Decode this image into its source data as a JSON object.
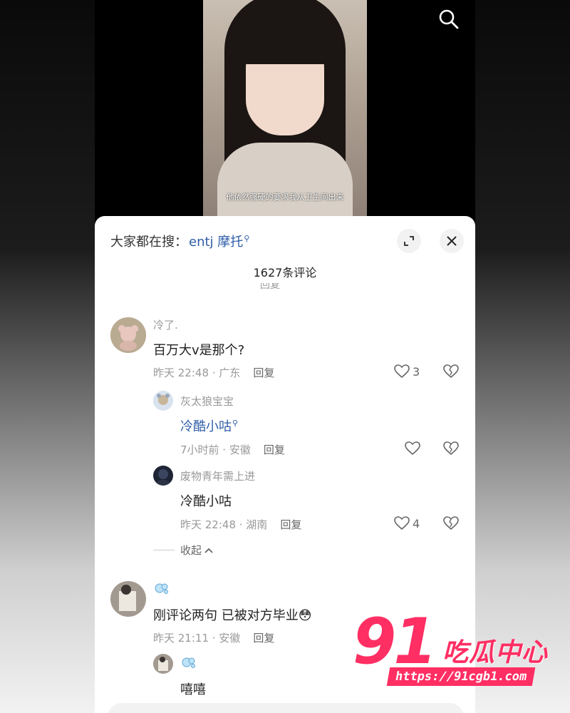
{
  "video": {
    "subtitle": "他依然强硬的要求我从卫生间出来",
    "search_icon": "search-icon"
  },
  "sheet": {
    "search_prefix": "大家都在搜：",
    "search_query": "entj 摩托",
    "expand_icon": "expand-icon",
    "close_icon": "close-icon",
    "comment_count": "1627条评论",
    "partial_row_reply": "回复"
  },
  "comments": [
    {
      "username": "冷了.",
      "text": "百万大v是那个?",
      "time_loc": "昨天 22:48 · 广东",
      "reply": "回复",
      "likes": "3",
      "replies": [
        {
          "username": "灰太狼宝宝",
          "text": "冷酷小咕",
          "time_loc": "7小时前 · 安徽",
          "reply": "回复",
          "likes": ""
        },
        {
          "username": "废物青年需上进",
          "text": "冷酷小咕",
          "time_loc": "昨天 22:48 · 湖南",
          "reply": "回复",
          "likes": "4"
        }
      ],
      "collapse_label": "收起"
    },
    {
      "username": "",
      "text": "刚评论两句 已被对方毕业😳",
      "time_loc": "昨天 21:11 · 安徽",
      "reply": "回复",
      "replies": [
        {
          "username": "",
          "text": "嘻嘻"
        }
      ]
    }
  ],
  "watermark": {
    "number": "91",
    "brand": "吃瓜中心",
    "url": "https://91cgb1.com"
  },
  "colors": {
    "link": "#2f5da8",
    "brand": "#ff2e63"
  }
}
